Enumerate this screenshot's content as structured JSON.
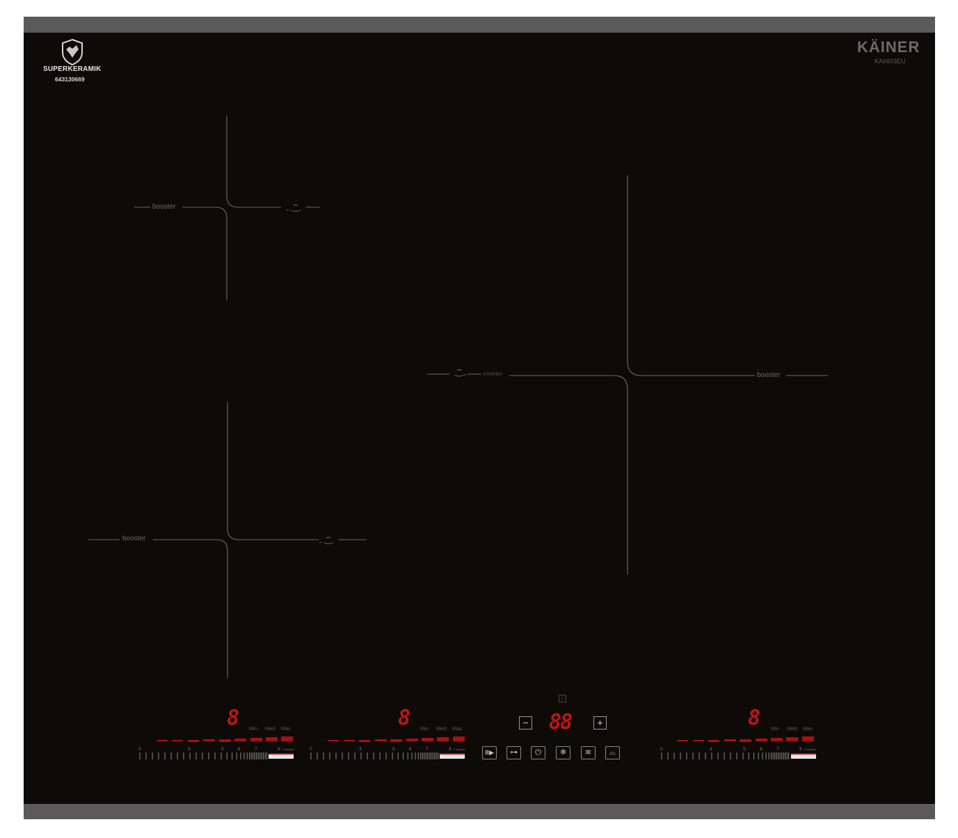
{
  "brand": {
    "name": "SUPERKERAMIK",
    "code": "643130669",
    "logo_icon": "shield-wolf-logo"
  },
  "maker": {
    "name": "KÄINER",
    "model": "KA6603EU"
  },
  "zones": {
    "top_left": {
      "label": "booster",
      "icon": "pot-icon"
    },
    "bottom_left": {
      "label": "booster",
      "icon": "pot-icon"
    },
    "right": {
      "label": "booster",
      "mode_label": "inverter",
      "icon": "pot-icon"
    }
  },
  "sliders": [
    {
      "display": "8",
      "min": "Min",
      "med": "Med",
      "max": "Max",
      "ticks": [
        "0",
        "3",
        "5",
        "6",
        "7",
        "9"
      ],
      "boost": "P booster"
    },
    {
      "display": "8",
      "min": "Min",
      "med": "Med",
      "max": "Max",
      "ticks": [
        "0",
        "3",
        "5",
        "6",
        "7",
        "9"
      ],
      "boost": "P booster"
    },
    {
      "display": "8",
      "min": "Min",
      "med": "Med",
      "max": "Max",
      "ticks": [
        "0",
        "3",
        "5",
        "6",
        "7",
        "9"
      ],
      "boost": "P booster"
    }
  ],
  "timer": {
    "display": "88",
    "minus": "−",
    "plus": "+"
  },
  "controls": [
    {
      "name": "pause-icon",
      "glyph": "Ⅲ▶"
    },
    {
      "name": "key-lock-icon",
      "glyph": "⊶"
    },
    {
      "name": "power-icon",
      "glyph": "⏻"
    },
    {
      "name": "defrost-icon",
      "glyph": "❄"
    },
    {
      "name": "keep-warm-icon",
      "glyph": "≋"
    },
    {
      "name": "pan-icon",
      "glyph": "⌓"
    }
  ],
  "colors": {
    "glass": "#0d0a08",
    "frame": "#5a5a5a",
    "led_red": "#c01414",
    "zone_line": "#6a6a6a"
  }
}
